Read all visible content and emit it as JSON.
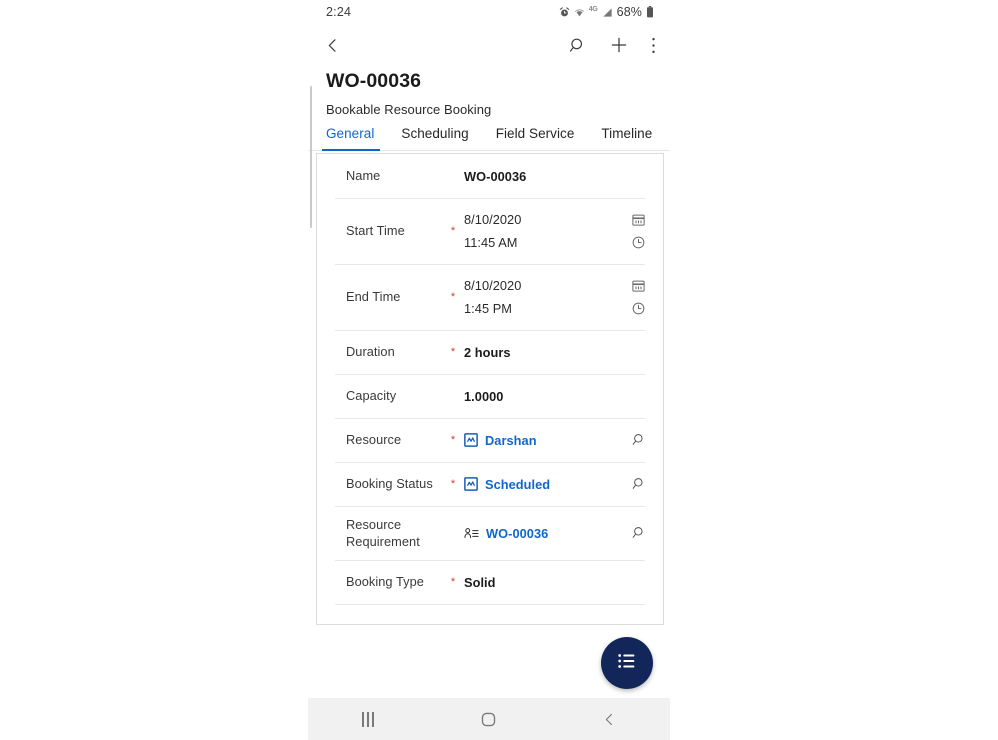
{
  "status_bar": {
    "time": "2:24",
    "battery_percent": "68%",
    "network_label": "4G",
    "icons": [
      "alarm-icon",
      "wifi-icon",
      "network-4g-icon",
      "signal-bars-icon",
      "battery-icon"
    ]
  },
  "command_bar": {
    "back_icon": "chevron-left-icon",
    "search_icon": "search-icon",
    "add_icon": "plus-icon",
    "more_icon": "overflow-menu-icon"
  },
  "record": {
    "title": "WO-00036",
    "entity": "Bookable Resource Booking"
  },
  "tabs": [
    {
      "label": "General",
      "active": true
    },
    {
      "label": "Scheduling",
      "active": false
    },
    {
      "label": "Field Service",
      "active": false
    },
    {
      "label": "Timeline",
      "active": false
    }
  ],
  "form": {
    "fields": {
      "name": {
        "label": "Name",
        "value": "WO-00036"
      },
      "start_time": {
        "label": "Start Time",
        "required": "*",
        "date": "8/10/2020",
        "time": "11:45 AM",
        "date_icon": "calendar-icon",
        "time_icon": "clock-icon"
      },
      "end_time": {
        "label": "End Time",
        "required": "*",
        "date": "8/10/2020",
        "time": "1:45 PM",
        "date_icon": "calendar-icon",
        "time_icon": "clock-icon"
      },
      "duration": {
        "label": "Duration",
        "required": "*",
        "value": "2 hours"
      },
      "capacity": {
        "label": "Capacity",
        "value": "1.0000"
      },
      "resource": {
        "label": "Resource",
        "required": "*",
        "value": "Darshan",
        "entity_icon": "bookable-resource-icon",
        "lookup_icon": "lookup-search-icon"
      },
      "booking_status": {
        "label": "Booking Status",
        "required": "*",
        "value": "Scheduled",
        "entity_icon": "booking-status-icon",
        "lookup_icon": "lookup-search-icon"
      },
      "resource_requirement": {
        "label": "Resource Requirement",
        "value": "WO-00036",
        "entity_icon": "resource-requirement-icon",
        "lookup_icon": "lookup-search-icon"
      },
      "booking_type": {
        "label": "Booking Type",
        "required": "*",
        "value": "Solid"
      }
    }
  },
  "fab": {
    "icon": "list-menu-icon"
  },
  "android_nav": {
    "recents_icon": "recents-icon",
    "home_icon": "home-circle-icon",
    "back_icon": "back-chevron-icon"
  },
  "colors": {
    "accent_blue": "#1166cc",
    "required_red": "#d63a2f",
    "fab_navy": "#12265a",
    "divider": "#e8e8e8",
    "card_border": "#dcdcdc",
    "nav_bg": "#f1f1f1"
  }
}
